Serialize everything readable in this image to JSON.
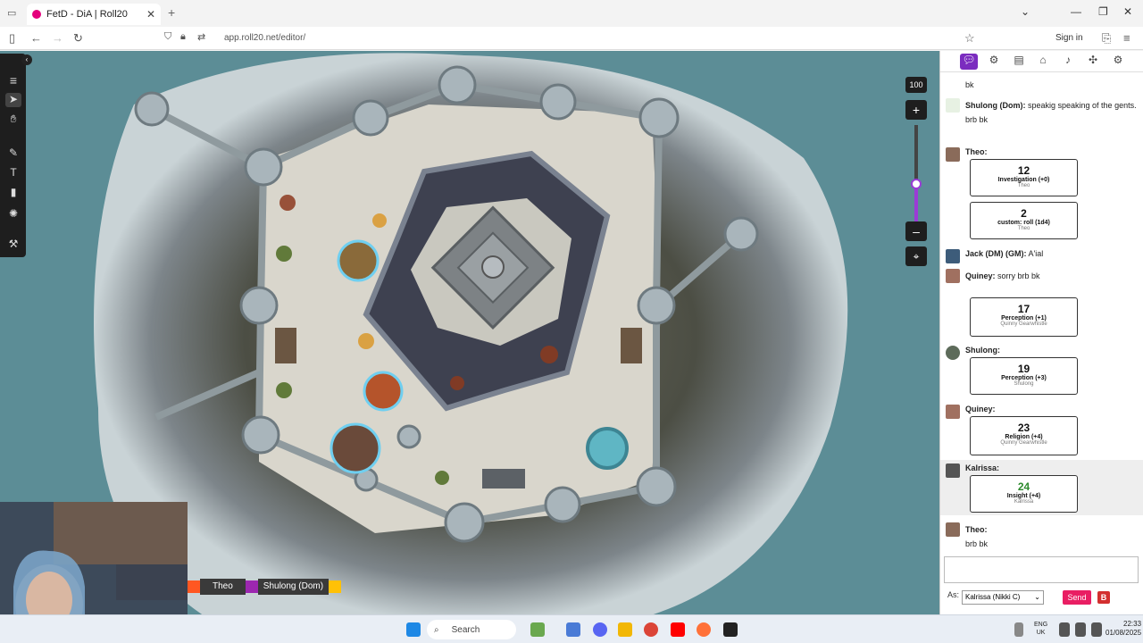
{
  "browser": {
    "tab_title": "FetD - DiA | Roll20",
    "url": "app.roll20.net/editor/",
    "sign_in": "Sign in"
  },
  "map": {
    "zoom": "100",
    "tokens": [
      "Theo",
      "Shulong (Dom)"
    ]
  },
  "chat": {
    "messages": [
      {
        "who": "",
        "text": "bk"
      },
      {
        "who": "Shulong (Dom):",
        "text": "speakig speaking of the gents. brb bk"
      },
      {
        "who": "Theo:",
        "text": ""
      },
      {
        "who": "Jack (DM) (GM):",
        "text": "A'ial"
      },
      {
        "who": "Quiney:",
        "text": "sorry brb bk"
      },
      {
        "who": "Shulong:",
        "text": ""
      },
      {
        "who": "Quiney:",
        "text": ""
      },
      {
        "who": "Kalrissa:",
        "text": ""
      },
      {
        "who": "Theo:",
        "text": "brb bk"
      }
    ],
    "rolls": [
      {
        "num": "12",
        "label": "Investigation (+0)",
        "sub": "Theo"
      },
      {
        "num": "2",
        "label": "custom: roll (1d4)",
        "sub": "Theo"
      },
      {
        "num": "17",
        "label": "Perception (+1)",
        "sub": "Quinny Gearwhistle"
      },
      {
        "num": "19",
        "label": "Perception (+3)",
        "sub": "Shulong"
      },
      {
        "num": "23",
        "label": "Religion (+4)",
        "sub": "Quinny Gearwhistle"
      },
      {
        "num": "24",
        "label": "Insight (+4)",
        "sub": "Kalrissa"
      }
    ],
    "as_label": "As:",
    "as_value": "Kalrissa (Nikki C)",
    "send": "Send"
  },
  "taskbar": {
    "search": "Search",
    "lang1": "ENG",
    "lang2": "UK",
    "time": "22:33",
    "date": "01/08/2025"
  },
  "colors": {
    "accent": "#7b2cbf",
    "send": "#e91e63",
    "theo": "#ff5722",
    "shulong": "#9c27b0",
    "third": "#ffc107"
  }
}
